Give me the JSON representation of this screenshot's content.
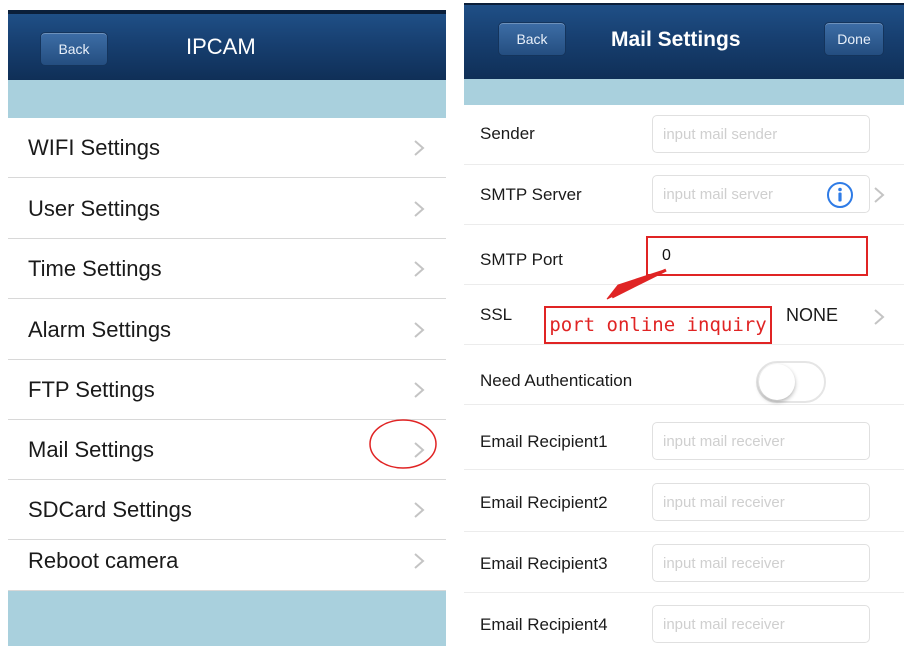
{
  "left_screen": {
    "nav": {
      "back_label": "Back",
      "title": "IPCAM"
    },
    "menu": [
      {
        "label": "WIFI Settings"
      },
      {
        "label": "User Settings"
      },
      {
        "label": "Time Settings"
      },
      {
        "label": "Alarm Settings"
      },
      {
        "label": "FTP Settings"
      },
      {
        "label": "Mail Settings"
      },
      {
        "label": "SDCard Settings"
      },
      {
        "label": "Reboot camera"
      }
    ]
  },
  "right_screen": {
    "nav": {
      "back_label": "Back",
      "title": "Mail Settings",
      "done_label": "Done"
    },
    "fields": {
      "sender": {
        "label": "Sender",
        "value": "",
        "placeholder": "input mail sender"
      },
      "smtp_server": {
        "label": "SMTP Server",
        "value": "",
        "placeholder": "input mail server"
      },
      "smtp_port": {
        "label": "SMTP Port",
        "value": "0"
      },
      "ssl": {
        "label": "SSL",
        "value": "NONE"
      },
      "need_auth": {
        "label": "Need Authentication",
        "enabled": false
      },
      "recipients": [
        {
          "label": "Email Recipient1",
          "value": "",
          "placeholder": "input mail receiver"
        },
        {
          "label": "Email Recipient2",
          "value": "",
          "placeholder": "input mail receiver"
        },
        {
          "label": "Email Recipient3",
          "value": "",
          "placeholder": "input mail receiver"
        },
        {
          "label": "Email Recipient4",
          "value": "",
          "placeholder": "input mail receiver"
        }
      ]
    }
  },
  "annotations": {
    "callout_text": "port online inquiry"
  },
  "icons": {
    "chevron": "chevron-right-icon",
    "info": "info-icon"
  },
  "colors": {
    "navbar": "#173f70",
    "strip": "#a9d0dd",
    "annotation_red": "#e02424",
    "info_blue": "#2e7be6"
  }
}
